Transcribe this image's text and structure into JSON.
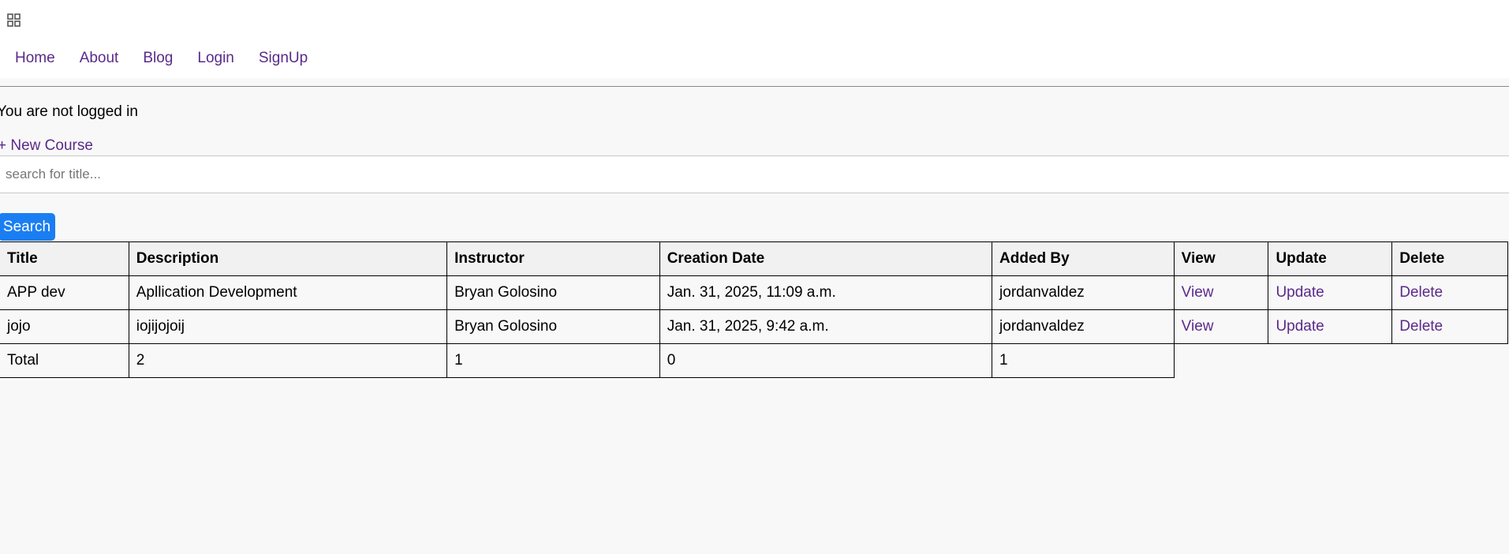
{
  "nav": {
    "menu_icon": "grid-icon",
    "links": [
      "Home",
      "About",
      "Blog",
      "Login",
      "SignUp"
    ]
  },
  "status_text": "You are not logged in",
  "new_course_label": "+ New Course",
  "search": {
    "placeholder": "search for title...",
    "value": "",
    "button_label": "Search"
  },
  "table": {
    "headers": [
      "Title",
      "Description",
      "Instructor",
      "Creation Date",
      "Added By",
      "View",
      "Update",
      "Delete"
    ],
    "rows": [
      {
        "title": "APP dev",
        "description": "Apllication Development",
        "instructor": "Bryan Golosino",
        "creation_date": "Jan. 31, 2025, 11:09 a.m.",
        "added_by": "jordanvaldez",
        "view": "View",
        "update": "Update",
        "delete": "Delete"
      },
      {
        "title": "jojo",
        "description": "iojijojoij",
        "instructor": "Bryan Golosino",
        "creation_date": "Jan. 31, 2025, 9:42 a.m.",
        "added_by": "jordanvaldez",
        "view": "View",
        "update": "Update",
        "delete": "Delete"
      }
    ],
    "totals": {
      "label": "Total",
      "description": "2",
      "instructor": "1",
      "creation_date": "0",
      "added_by": "1"
    }
  },
  "colors": {
    "link": "#5a2a8a",
    "button": "#1a7ef2",
    "page_bg": "#f8f8f8",
    "header_bg": "#f1f1f1"
  }
}
